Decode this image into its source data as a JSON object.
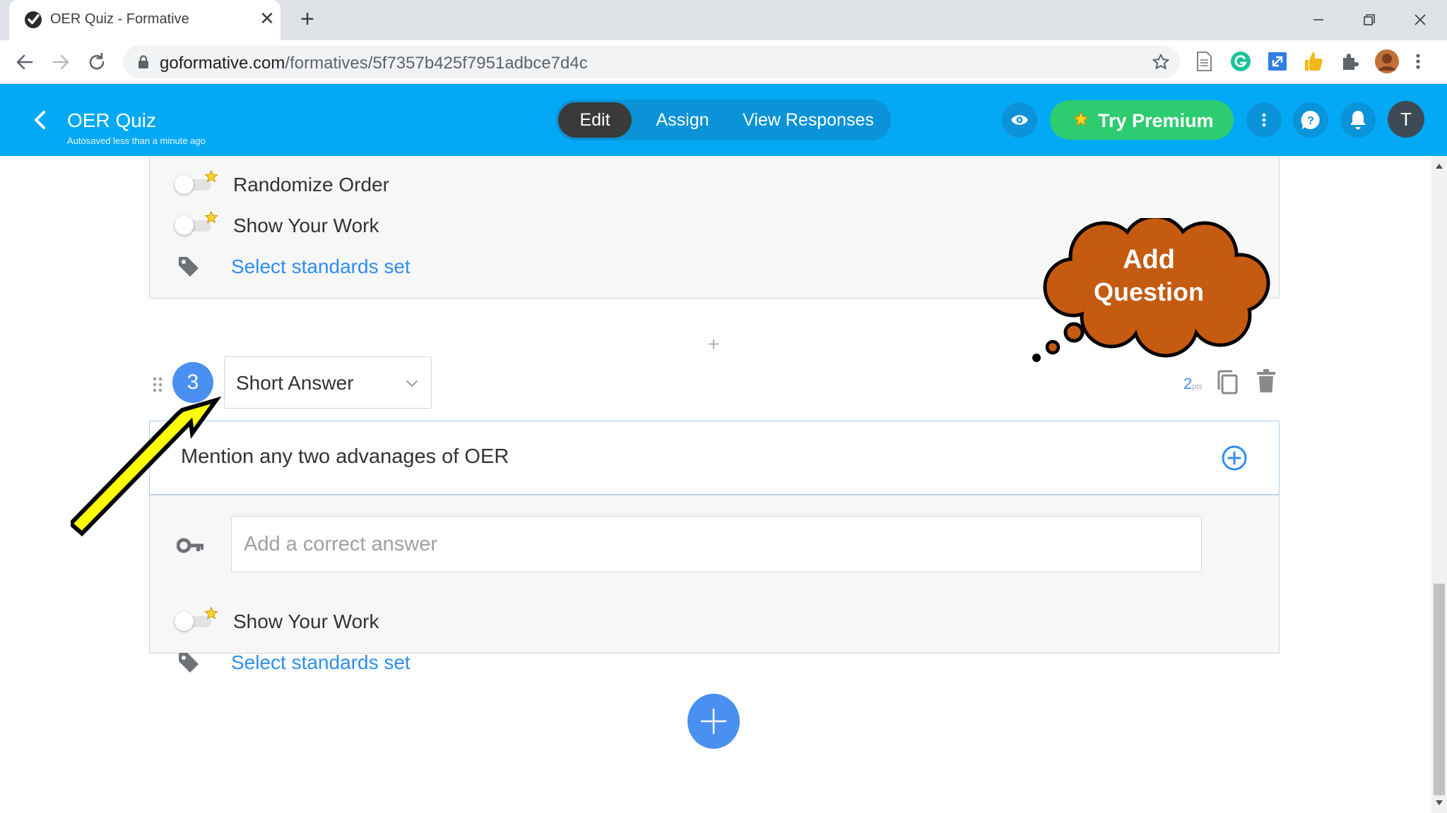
{
  "browser": {
    "tab_title": "OER Quiz - Formative",
    "close_glyph": "✕",
    "new_tab_glyph": "+",
    "url_domain": "goformative.com",
    "url_path": "/formatives/5f7357b425f7951adbce7d4c"
  },
  "header": {
    "title": "OER Quiz",
    "autosave": "Autosaved less than a minute ago",
    "modes": [
      "Edit",
      "Assign",
      "View Responses"
    ],
    "active_mode": "Edit",
    "premium_label": "Try Premium",
    "avatar_initial": "T",
    "brand_color": "#03a9f4",
    "premium_color": "#2ecc71"
  },
  "prev_question": {
    "options": [
      "Randomize Order",
      "Show Your Work"
    ],
    "standards_link": "Select standards set"
  },
  "add_between_glyph": "+",
  "question": {
    "number": "3",
    "type": "Short Answer",
    "points_value": "2",
    "points_unit": "pts",
    "prompt": "Mention any two advanages of OER",
    "answer_placeholder": "Add a correct answer",
    "option": "Show Your Work",
    "standards_link": "Select standards set"
  },
  "callout": {
    "line1": "Add",
    "line2": "Question",
    "color": "#c55a11"
  },
  "arrow_color": "#ffff00"
}
